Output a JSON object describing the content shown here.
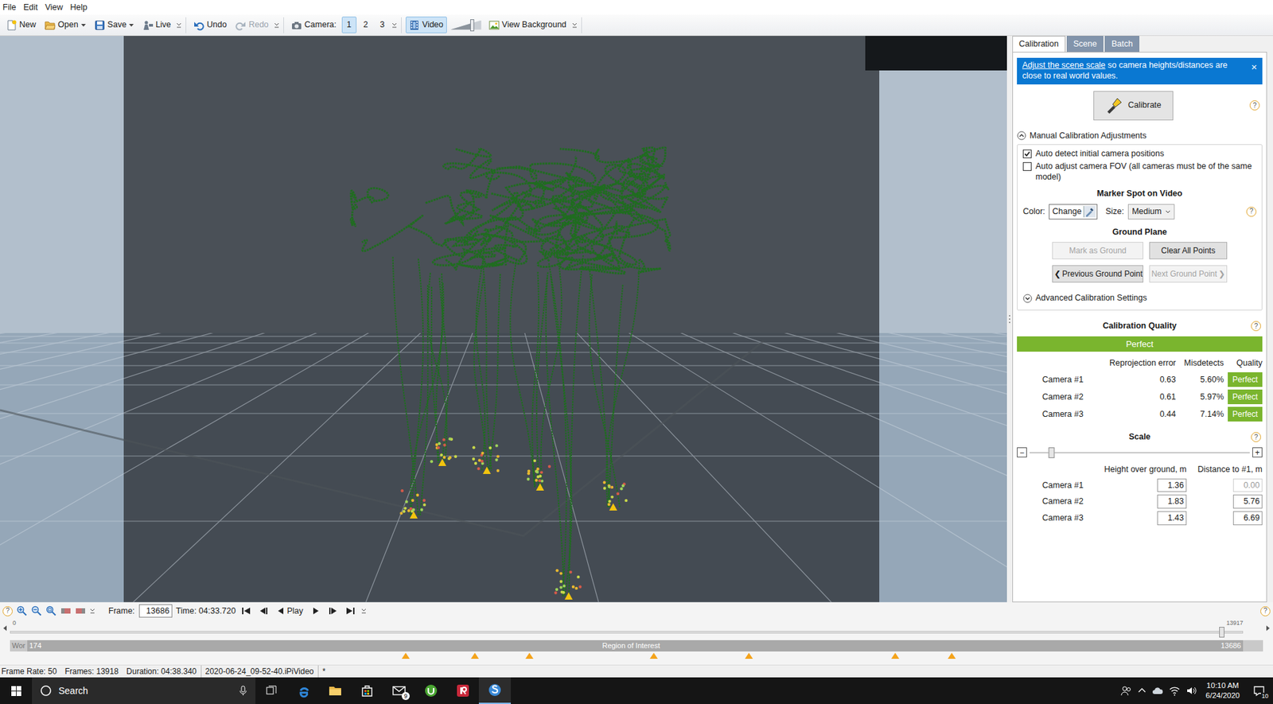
{
  "menu": [
    {
      "label": "File"
    },
    {
      "label": "Edit"
    },
    {
      "label": "View"
    },
    {
      "label": "Help"
    }
  ],
  "toolbar": {
    "groups": [
      {
        "items": [
          {
            "kind": "button",
            "label": "New",
            "disabled": false
          },
          {
            "kind": "split",
            "label": "Open",
            "disabled": false
          },
          {
            "kind": "split",
            "label": "Save",
            "disabled": false
          },
          {
            "kind": "button",
            "label": "Live",
            "disabled": false
          }
        ]
      },
      {
        "items": [
          {
            "kind": "button",
            "label": "Undo",
            "disabled": false
          },
          {
            "kind": "button",
            "label": "Redo",
            "disabled": true
          }
        ]
      },
      {
        "items": [
          {
            "kind": "label",
            "label": "Camera:"
          },
          {
            "kind": "toggle",
            "label": "1",
            "selected": true
          },
          {
            "kind": "toggle",
            "label": "2",
            "selected": false
          },
          {
            "kind": "toggle",
            "label": "3",
            "selected": false
          }
        ]
      },
      {
        "items": [
          {
            "kind": "toggle",
            "label": "Video",
            "selected": true
          },
          {
            "kind": "slider",
            "level": 0.7
          },
          {
            "kind": "button",
            "label": "View Background",
            "disabled": false
          }
        ]
      }
    ]
  },
  "panel": {
    "tabs": [
      {
        "label": "Calibration",
        "selected": true
      },
      {
        "label": "Scene",
        "selected": false
      },
      {
        "label": "Batch",
        "selected": false
      }
    ],
    "banner": {
      "link": "Adjust the scene scale",
      "text": " so camera heights/distances are close to real world values.",
      "close": "×"
    },
    "calibrate": {
      "label": "Calibrate",
      "help": "?"
    },
    "manual": {
      "title": "Manual Calibration Adjustments",
      "expanded": true
    },
    "checks": [
      {
        "label": "Auto detect initial camera positions",
        "checked": true
      },
      {
        "label": "Auto adjust camera FOV (all cameras must be of the same model)",
        "checked": false
      }
    ],
    "marker": {
      "title": "Marker Spot on Video",
      "color_label": "Color:",
      "change": "Change",
      "size_label": "Size:",
      "size": "Medium",
      "help": "?"
    },
    "ground": {
      "title": "Ground Plane",
      "buttons": [
        {
          "label": "Mark as Ground",
          "disabled": true
        },
        {
          "label": "Clear All Points",
          "disabled": false
        },
        {
          "label": "Previous Ground Point",
          "disabled": false,
          "prefix": "❮"
        },
        {
          "label": "Next Ground Point",
          "disabled": true,
          "suffix": "❯"
        }
      ]
    },
    "advanced": {
      "title": "Advanced Calibration Settings",
      "expanded": false
    },
    "quality": {
      "title": "Calibration Quality",
      "help": "?",
      "overall": "Perfect",
      "columns": [
        "Reprojection error",
        "Misdetects",
        "Quality"
      ],
      "rows": [
        {
          "camera": "Camera #1",
          "error": "0.63",
          "misdetects": "5.60%",
          "quality": "Perfect"
        },
        {
          "camera": "Camera #2",
          "error": "0.61",
          "misdetects": "5.97%",
          "quality": "Perfect"
        },
        {
          "camera": "Camera #3",
          "error": "0.44",
          "misdetects": "7.14%",
          "quality": "Perfect"
        }
      ]
    },
    "scale": {
      "title": "Scale",
      "help": "?",
      "minus": "−",
      "plus": "+",
      "level": 0.1,
      "columns": [
        "Height over ground, m",
        "Distance to #1, m"
      ],
      "rows": [
        {
          "camera": "Camera #1",
          "height": "1.36",
          "distance": "0.00",
          "distance_disabled": true
        },
        {
          "camera": "Camera #2",
          "height": "1.83",
          "distance": "5.76",
          "distance_disabled": false
        },
        {
          "camera": "Camera #3",
          "height": "1.43",
          "distance": "6.69",
          "distance_disabled": false
        }
      ]
    }
  },
  "timeline": {
    "help_left": "?",
    "help_right": "?",
    "frame_label": "Frame:",
    "frame": "13686",
    "time": "Time: 04:33.720",
    "play": "Play",
    "ruler": {
      "start": "0",
      "end": "13917",
      "level": 0.983
    },
    "roi": {
      "prefix": "Wor",
      "start": "174",
      "label": "Region of Interest",
      "end": "13686"
    },
    "markers": [
      {
        "level": 0.321
      },
      {
        "level": 0.377
      },
      {
        "level": 0.421
      },
      {
        "level": 0.522
      },
      {
        "level": 0.599
      },
      {
        "level": 0.718
      },
      {
        "level": 0.764
      }
    ]
  },
  "status": {
    "items": [
      "Frame Rate: 50",
      "Frames: 13918",
      "Duration: 04:38.340",
      "2020-06-24_09-52-40.iPiVideo",
      "*"
    ]
  },
  "taskbar": {
    "search": "Search",
    "apps": [
      {
        "active": false
      },
      {
        "active": false
      },
      {
        "active": false
      },
      {
        "active": false,
        "badge": "9"
      },
      {
        "active": false
      },
      {
        "active": false
      },
      {
        "active": true
      }
    ],
    "time": "10:10 AM",
    "date": "6/24/2020",
    "notifications": "10"
  }
}
